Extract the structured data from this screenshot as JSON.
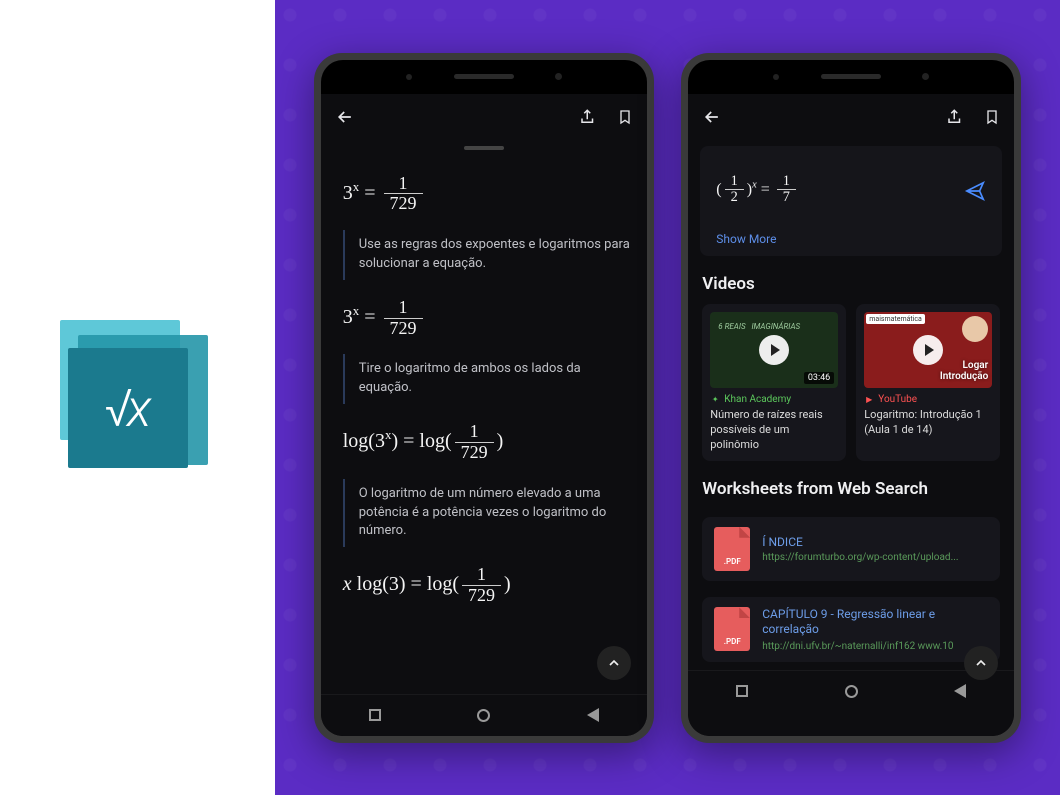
{
  "app_logo_symbol": "√x",
  "phone1": {
    "eq1": {
      "base": "3",
      "exp": "x",
      "eq": "=",
      "num": "1",
      "den": "729"
    },
    "hint1": "Use as regras dos expoentes e logaritmos para solucionar a equação.",
    "eq2": {
      "base": "3",
      "exp": "x",
      "eq": "=",
      "num": "1",
      "den": "729"
    },
    "hint2": "Tire o logaritmo de ambos os lados da equação.",
    "eq3": {
      "lhs_open": "log(",
      "lhs_base": "3",
      "lhs_exp": "x",
      "lhs_close": ")",
      "eq": "=",
      "rhs_open": "log(",
      "num": "1",
      "den": "729",
      "rhs_close": ")"
    },
    "hint3": "O logaritmo de um número elevado a uma potência é a potência vezes o logaritmo do número.",
    "eq4": {
      "coef": "x",
      "fn": "log(3)",
      "eq": "=",
      "rhs_open": "log(",
      "num": "1",
      "den": "729",
      "rhs_close": ")"
    }
  },
  "phone2": {
    "input_eq": {
      "open": "(",
      "num": "1",
      "den": "2",
      "close": ")",
      "exp": "x",
      "eq": "=",
      "rnum": "1",
      "rden": "7"
    },
    "show_more": "Show More",
    "videos_title": "Videos",
    "videos": [
      {
        "source": "Khan Academy",
        "title": "Número de raízes reais possíveis de um polinômio",
        "duration": "03:46"
      },
      {
        "source": "YouTube",
        "title": "Logaritmo: Introdução 1 (Aula 1 de 14)",
        "slide_top": "Logar",
        "slide_bottom": "Introdução",
        "brand": "maismatemática"
      }
    ],
    "worksheets_title": "Worksheets from Web Search",
    "worksheets": [
      {
        "title": "Í NDICE",
        "url": "https://forumturbo.org/wp-content/upload..."
      },
      {
        "title": "CAPÍTULO 9 - Regressão linear e correlação",
        "url": "http://dni.ufv.br/~naternalli/inf162 www.10"
      }
    ],
    "pdf_label": ".PDF"
  }
}
